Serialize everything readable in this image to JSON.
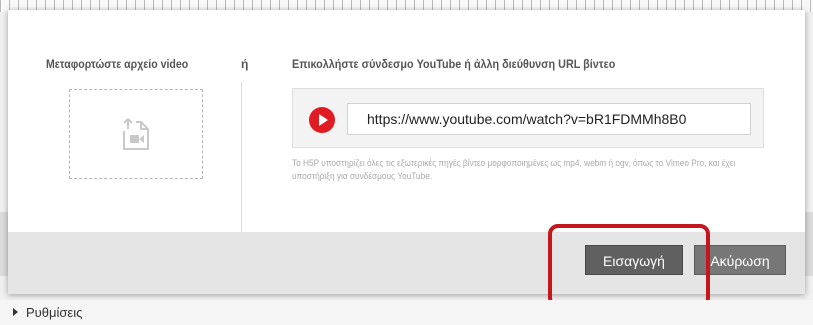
{
  "upload": {
    "title": "Μεταφορτώστε αρχείο video",
    "icon": "file-upload-icon"
  },
  "separator": {
    "or_label": "ή"
  },
  "url_section": {
    "title": "Επικολλήστε σύνδεσμο YouTube ή άλλη διεύθυνση URL βίντεο",
    "icon": "youtube-play-icon",
    "input_value": "https://www.youtube.com/watch?v=bR1FDMMh8B0",
    "help_text": "Το H5P υποστηρίζει όλες τις εξωτερικές πηγές βίντεο μορφοποιημένες ως mp4, webm ή ogv, όπως το Vimeo Pro, και έχει υποστήριξη για συνδέσμους YouTube."
  },
  "footer": {
    "insert_label": "Εισαγωγή",
    "cancel_label": "Ακύρωση"
  },
  "settings": {
    "label": "Ρυθμίσεις"
  },
  "colors": {
    "highlight": "#c4161c",
    "youtube_red": "#e11b22",
    "button_gray": "#606060"
  }
}
